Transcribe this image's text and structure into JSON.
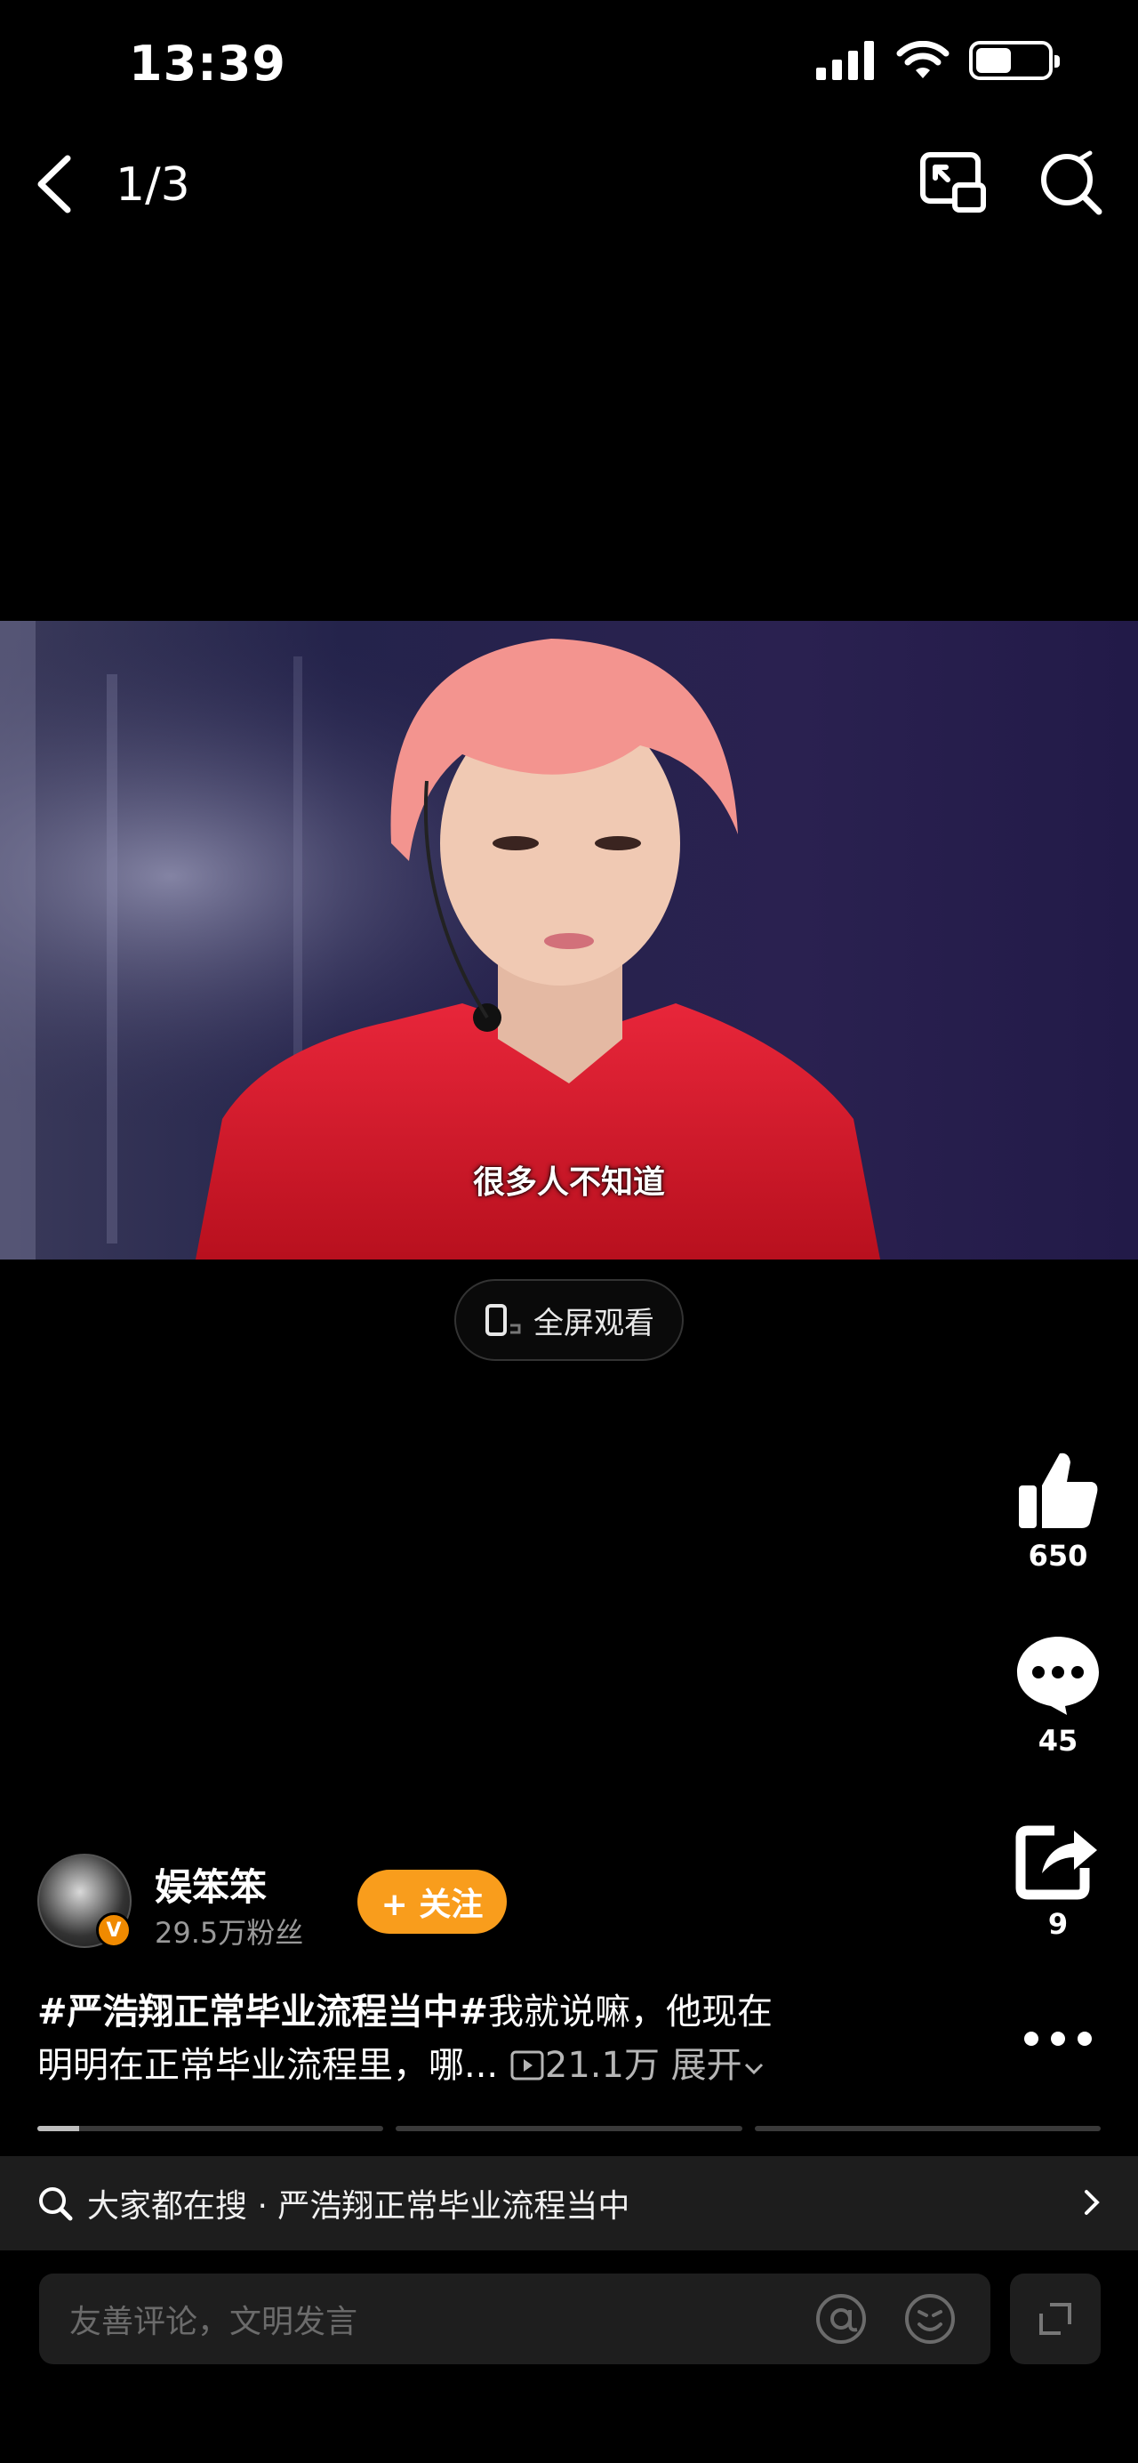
{
  "status_bar": {
    "time": "13:39",
    "battery_level": 0.55,
    "icons": [
      "signal-icon",
      "wifi-icon",
      "battery-icon"
    ]
  },
  "nav": {
    "counter": "1/3",
    "icons": [
      "back-icon",
      "picture-in-picture-icon",
      "search-icon"
    ]
  },
  "video": {
    "subtitle": "很多人不知道"
  },
  "fullscreen": {
    "label": "全屏观看"
  },
  "actions": {
    "likes": "650",
    "comments": "45",
    "shares": "9"
  },
  "author": {
    "name": "娱笨笨",
    "fans": "29.5万粉丝",
    "badge": "V",
    "follow_label": "+ 关注"
  },
  "caption": {
    "hashtag": "#严浩翔正常毕业流程当中#",
    "line1_text": "我就说嘛，他现在",
    "line2_text": "明明在正常毕业流程里，哪...",
    "plays": "21.1万",
    "expand_label": "展开"
  },
  "progress": {
    "active_segment_fill": 0.12
  },
  "search_suggest": {
    "text": "大家都在搜 · 严浩翔正常毕业流程当中"
  },
  "comment_box": {
    "placeholder": "友善评论，文明发言"
  },
  "colors": {
    "accent": "#f99d1c",
    "background": "#000000"
  }
}
